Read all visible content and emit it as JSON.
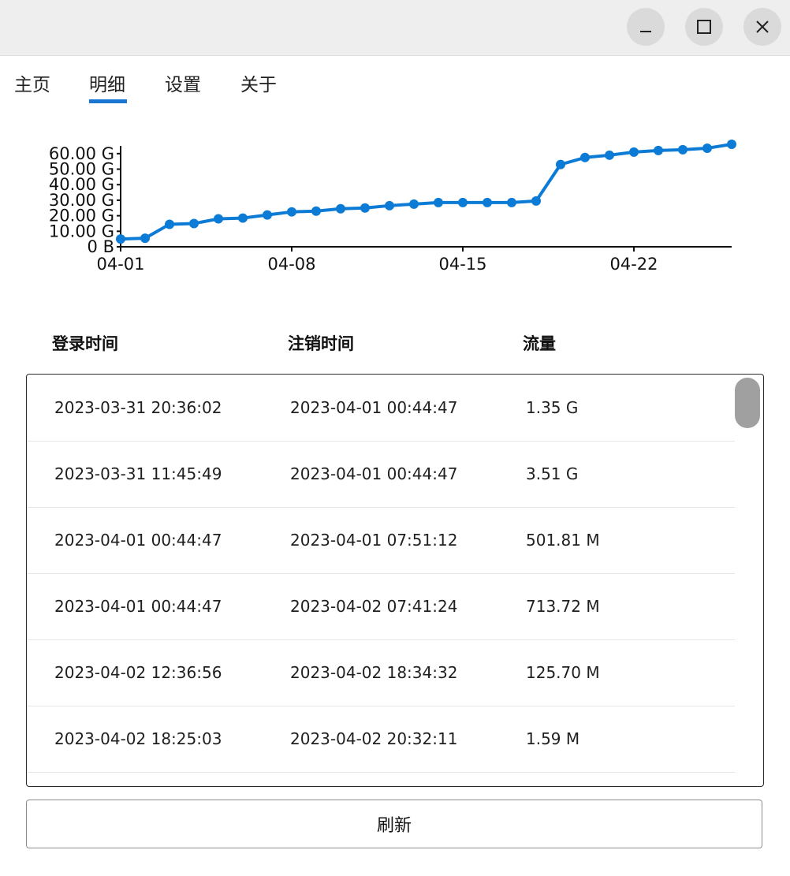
{
  "window": {
    "controls": [
      "minimize-icon",
      "maximize-icon",
      "close-icon"
    ]
  },
  "tabs": [
    {
      "label": "主页",
      "active": false
    },
    {
      "label": "明细",
      "active": true
    },
    {
      "label": "设置",
      "active": false
    },
    {
      "label": "关于",
      "active": false
    }
  ],
  "accent_color": "#1976d2",
  "chart_data": {
    "type": "line",
    "title": "",
    "xlabel": "",
    "ylabel": "",
    "ylim": [
      0,
      65
    ],
    "y_ticks": [
      "0 B",
      "10.00 G",
      "20.00 G",
      "30.00 G",
      "40.00 G",
      "50.00 G",
      "60.00 G"
    ],
    "x_ticks": [
      "04-01",
      "04-08",
      "04-15",
      "04-22"
    ],
    "line_color": "#0b7bd6",
    "series": [
      {
        "x": [
          "04-01",
          "04-02",
          "04-03",
          "04-04",
          "04-05",
          "04-06",
          "04-07",
          "04-08",
          "04-09",
          "04-10",
          "04-11",
          "04-12",
          "04-13",
          "04-14",
          "04-15",
          "04-16",
          "04-17",
          "04-18",
          "04-19",
          "04-20",
          "04-21",
          "04-22",
          "04-23",
          "04-24",
          "04-25",
          "04-26"
        ],
        "values": [
          5,
          5.5,
          14.5,
          15,
          18,
          18.5,
          20.5,
          22.5,
          23,
          24.5,
          25,
          26.5,
          27.5,
          28.5,
          28.5,
          28.5,
          28.5,
          29.5,
          53,
          57.5,
          59,
          61,
          62,
          62.5,
          63.5,
          66
        ]
      }
    ]
  },
  "table": {
    "headers": [
      "登录时间",
      "注销时间",
      "流量"
    ],
    "rows": [
      [
        "2023-03-31 20:36:02",
        "2023-04-01 00:44:47",
        "1.35 G"
      ],
      [
        "2023-03-31 11:45:49",
        "2023-04-01 00:44:47",
        "3.51 G"
      ],
      [
        "2023-04-01 00:44:47",
        "2023-04-01 07:51:12",
        "501.81 M"
      ],
      [
        "2023-04-01 00:44:47",
        "2023-04-02 07:41:24",
        "713.72 M"
      ],
      [
        "2023-04-02 12:36:56",
        "2023-04-02 18:34:32",
        "125.70 M"
      ],
      [
        "2023-04-02 18:25:03",
        "2023-04-02 20:32:11",
        "1.59 M"
      ]
    ]
  },
  "refresh_label": "刷新"
}
